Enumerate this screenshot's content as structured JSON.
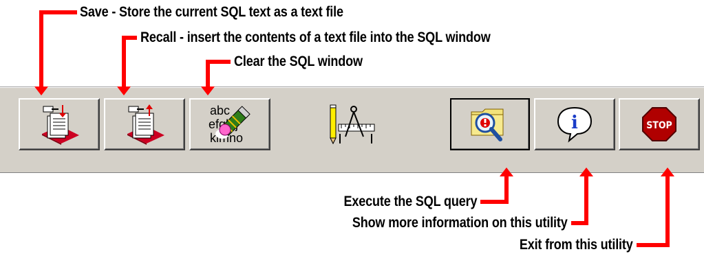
{
  "callouts": {
    "save": "Save - Store the current SQL text as a text file",
    "recall": "Recall - insert the contents of a text file into the SQL window",
    "clear": "Clear the SQL window",
    "execute": "Execute the SQL query",
    "info": "Show more information on this utility",
    "exit": "Exit from this utility"
  },
  "toolbar": {
    "clear_icon_text": [
      "abc",
      "efghij",
      "klmno"
    ],
    "stop_text": "STOP",
    "info_text": "i",
    "buttons": [
      {
        "name": "save",
        "icon": "save-file-icon"
      },
      {
        "name": "recall",
        "icon": "recall-file-icon"
      },
      {
        "name": "clear",
        "icon": "clear-eraser-icon"
      },
      {
        "name": "designer",
        "icon": "drafting-tools-icon"
      },
      {
        "name": "execute",
        "icon": "folder-magnifier-icon"
      },
      {
        "name": "info",
        "icon": "info-bubble-icon"
      },
      {
        "name": "exit",
        "icon": "stop-sign-icon"
      }
    ]
  },
  "colors": {
    "callout_line": "#ff0000",
    "toolbar_bg": "#d4d0c8",
    "stop_red": "#b00000"
  }
}
